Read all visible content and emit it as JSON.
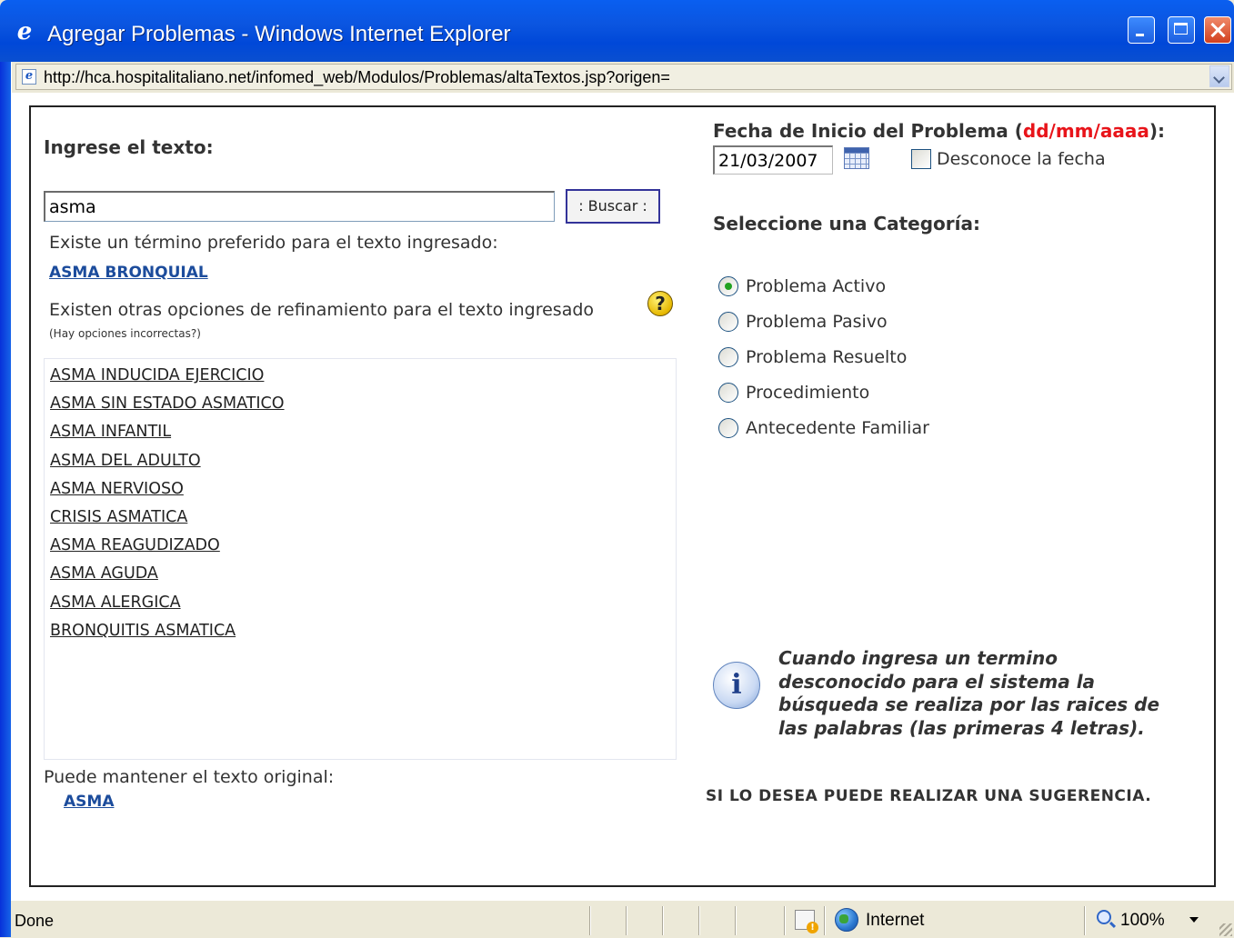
{
  "window": {
    "title": "Agregar Problemas - Windows Internet Explorer",
    "address": "http://hca.hospitalitaliano.net/infomed_web/Modulos/Problemas/altaTextos.jsp?origen="
  },
  "form": {
    "ingrese_label": "Ingrese el texto:",
    "search_value": "asma",
    "buscar_label": ": Buscar :",
    "preferred_intro": "Existe un término preferido para el texto ingresado:",
    "preferred_term": "ASMA BRONQUIAL",
    "refine_intro": "Existen otras opciones de refinamiento para el texto ingresado",
    "incorrect_note": "(Hay opciones incorrectas?)",
    "options": [
      "ASMA INDUCIDA EJERCICIO",
      "ASMA SIN ESTADO ASMATICO",
      "ASMA INFANTIL",
      "ASMA DEL ADULTO",
      "ASMA NERVIOSO",
      "CRISIS ASMATICA",
      "ASMA REAGUDIZADO",
      "ASMA AGUDA",
      "ASMA ALERGICA",
      "BRONQUITIS ASMATICA"
    ],
    "keep_original_label": "Puede mantener el texto original:",
    "original_term": "ASMA"
  },
  "date": {
    "label": "Fecha de Inicio del Problema",
    "format_open": " (",
    "format": "dd/mm/aaaa",
    "format_close": "):",
    "value": "21/03/2007",
    "unknown_label": "Desconoce la fecha",
    "unknown_checked": false
  },
  "category": {
    "label": "Seleccione una Categoría:",
    "options": [
      {
        "label": "Problema Activo",
        "checked": true
      },
      {
        "label": "Problema Pasivo",
        "checked": false
      },
      {
        "label": "Problema Resuelto",
        "checked": false
      },
      {
        "label": "Procedimiento",
        "checked": false
      },
      {
        "label": "Antecedente Familiar",
        "checked": false
      }
    ]
  },
  "info": {
    "text": "Cuando ingresa un termino desconocido para el sistema la búsqueda se realiza por las raices de las palabras (las primeras 4 letras).",
    "suggestion": "SI LO DESEA PUEDE REALIZAR UNA SUGERENCIA."
  },
  "status": {
    "text": "Done",
    "zone": "Internet",
    "zoom": "100%"
  },
  "icons": {
    "browser": "ie-logo-icon",
    "help": "question-icon",
    "calendar": "calendar-icon",
    "info": "info-icon",
    "security": "security-warning-icon",
    "zone": "globe-icon",
    "zoom": "zoom-icon"
  },
  "colors": {
    "titlebar": "#0a5ff0",
    "date_format": "#e8141a",
    "link": "#1c4c9c",
    "radio_checked": "#21a121"
  }
}
